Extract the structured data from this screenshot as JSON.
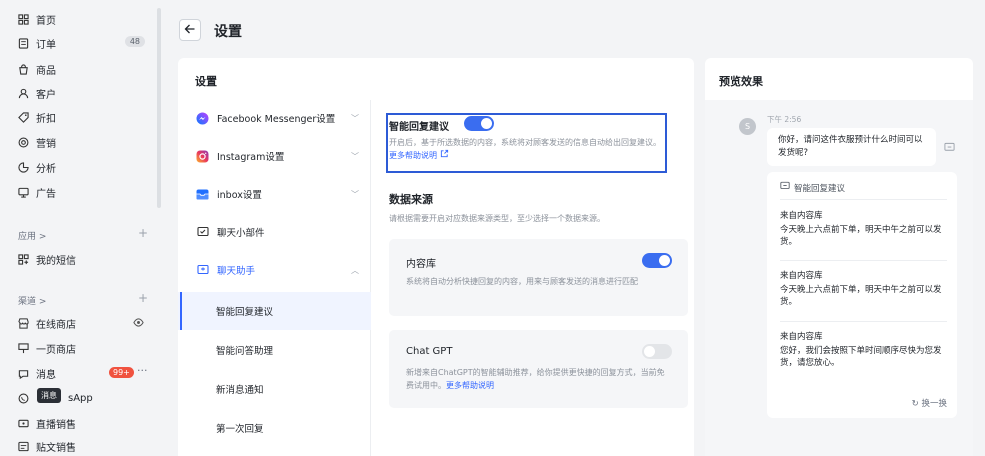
{
  "sidebar": {
    "items": [
      {
        "label": "首页",
        "icon": "grid-icon"
      },
      {
        "label": "订单",
        "icon": "order-icon",
        "badge": "48"
      },
      {
        "label": "商品",
        "icon": "bag-icon"
      },
      {
        "label": "客户",
        "icon": "user-icon"
      },
      {
        "label": "折扣",
        "icon": "tag-icon"
      },
      {
        "label": "营销",
        "icon": "target-icon"
      },
      {
        "label": "分析",
        "icon": "chart-icon"
      },
      {
        "label": "广告",
        "icon": "ad-icon"
      }
    ],
    "apps_section": "应用 >",
    "apps_items": [
      {
        "label": "我的短信",
        "icon": "apps-icon"
      }
    ],
    "channels_section": "渠道 >",
    "channel_items": [
      {
        "label": "在线商店",
        "icon": "store-icon"
      },
      {
        "label": "一页商店",
        "icon": "page-icon"
      },
      {
        "label": "消息",
        "icon": "message-icon",
        "badge": "99+"
      },
      {
        "label": "sApp",
        "icon": "whatsapp-icon"
      },
      {
        "label": "直播销售",
        "icon": "live-icon"
      },
      {
        "label": "贴文销售",
        "icon": "post-icon"
      }
    ],
    "tooltip": "消息"
  },
  "header": {
    "title": "设置"
  },
  "settings": {
    "title": "设置",
    "menu": [
      {
        "label": "Facebook Messenger设置",
        "icon": "messenger-icon"
      },
      {
        "label": "Instagram设置",
        "icon": "instagram-icon"
      },
      {
        "label": "inbox设置",
        "icon": "inbox-icon"
      },
      {
        "label": "聊天小部件",
        "icon": "widget-icon"
      },
      {
        "label": "聊天助手",
        "icon": "assistant-icon"
      }
    ],
    "submenu": [
      "智能回复建议",
      "智能问答助理",
      "新消息通知",
      "第一次回复"
    ],
    "smart_reply": {
      "title": "智能回复建议",
      "enabled": true,
      "desc": "开启后，基于所选数据的内容，系统将对顾客发送的信息自动给出回复建议。",
      "link": "更多帮助说明"
    },
    "data_source": {
      "title": "数据来源",
      "desc": "请根据需要开启对应数据来源类型，至少选择一个数据来源。",
      "sources": [
        {
          "name": "内容库",
          "enabled": true,
          "desc": "系统将自动分析快捷回复的内容，用来与顾客发送的消息进行匹配",
          "link": ""
        },
        {
          "name": "Chat GPT",
          "enabled": false,
          "desc": "新增来自ChatGPT的智能辅助推荐，给你提供更快捷的回复方式，当前免费试用中。",
          "link": "更多帮助说明"
        }
      ]
    }
  },
  "preview": {
    "title": "预览效果",
    "avatar": "S",
    "time": "下午 2:56",
    "message": "你好，请问这件衣服预计什么时间可以发货呢?",
    "suggestion_header": "智能回复建议",
    "suggestions": [
      {
        "source": "来自内容库",
        "text": "今天晚上六点前下单，明天中午之前可以发货。"
      },
      {
        "source": "来自内容库",
        "text": "今天晚上六点前下单，明天中午之前可以发货。"
      },
      {
        "source": "来自内容库",
        "text": "您好，我们会按照下单时间顺序尽快为您发货，请您放心。"
      }
    ],
    "refresh": "换一换"
  }
}
